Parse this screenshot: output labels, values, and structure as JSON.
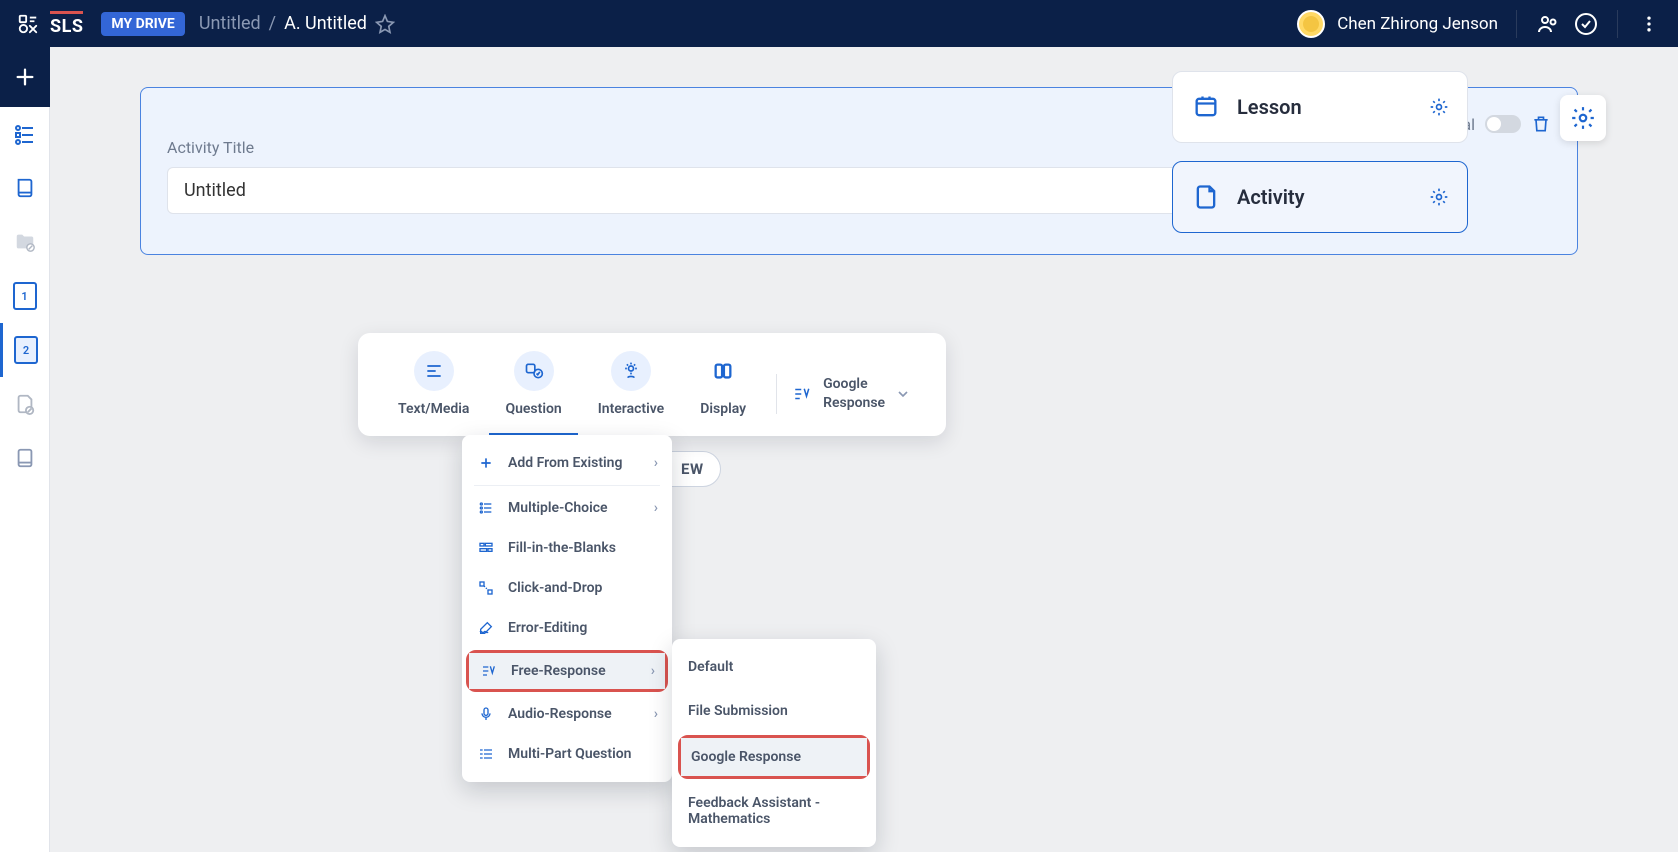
{
  "header": {
    "drive_badge": "MY DRIVE",
    "breadcrumb_dim": "Untitled",
    "breadcrumb_sep": "/",
    "breadcrumb_current": "A. Untitled",
    "user_name": "Chen Zhirong Jenson"
  },
  "activity": {
    "label": "Activity Title",
    "value": "Untitled",
    "optional_label": "Optional"
  },
  "right_panel": {
    "lesson": "Lesson",
    "activity": "Activity"
  },
  "toolbar": {
    "tabs": {
      "text_media": "Text/Media",
      "question": "Question",
      "interactive": "Interactive",
      "display": "Display"
    },
    "picker_line1": "Google",
    "picker_line2": "Response"
  },
  "addnew_peek": "EW",
  "dropdown": {
    "add_from_existing": "Add From Existing",
    "multiple_choice": "Multiple-Choice",
    "fill_blanks": "Fill-in-the-Blanks",
    "click_drop": "Click-and-Drop",
    "error_editing": "Error-Editing",
    "free_response": "Free-Response",
    "audio_response": "Audio-Response",
    "multi_part": "Multi-Part Question"
  },
  "submenu": {
    "default": "Default",
    "file_submission": "File Submission",
    "google_response": "Google Response",
    "feedback_math": "Feedback Assistant - Mathematics"
  },
  "rail": {
    "page1": "1",
    "page2": "2"
  }
}
